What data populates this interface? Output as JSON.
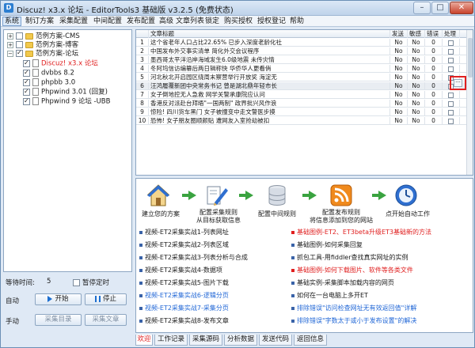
{
  "window": {
    "title": "Discuz! x3.x 论坛 - EditorTools3 基础版 v3.2.5 (免费状态)",
    "app_icon": "D",
    "min_glyph": "–",
    "max_glyph": "□",
    "close_glyph": "✕"
  },
  "menu": [
    "系统",
    "制订方案",
    "采集配置",
    "中间配置",
    "发布配置",
    "高级",
    "文章列表",
    "锁定",
    "购买授权",
    "授权登记",
    "帮助"
  ],
  "tree": [
    {
      "label": "范例方案-CMS",
      "exp": "+",
      "checked": false,
      "kind": "folder"
    },
    {
      "label": "范例方案-博客",
      "exp": "+",
      "checked": false,
      "kind": "folder"
    },
    {
      "label": "范例方案-论坛",
      "exp": "−",
      "checked": true,
      "kind": "folder"
    },
    {
      "label": "Discuz! x3.x 论坛",
      "checked": true,
      "kind": "doc",
      "red": true
    },
    {
      "label": "dvbbs 8.2",
      "checked": true,
      "kind": "doc"
    },
    {
      "label": "phpbb 3.0",
      "checked": true,
      "kind": "doc"
    },
    {
      "label": "Phpwind 3.01 (回复)",
      "checked": true,
      "kind": "doc"
    },
    {
      "label": "Phpwind 9 论坛 -UBB",
      "checked": true,
      "kind": "doc"
    }
  ],
  "controls": {
    "wait_label": "等待时间:",
    "wait_value": "5",
    "pause_label": "暂停定时",
    "auto_label": "自动",
    "start_label": "开始",
    "stop_label": "停止",
    "manual_label": "手动",
    "collect_list_label": "采集目录",
    "collect_article_label": "采集文章"
  },
  "grid": {
    "headers": [
      "",
      "文章标题",
      "发送",
      "敏感",
      "错误",
      "处理"
    ],
    "rows": [
      {
        "n": "1",
        "title": "这个省老年人口占比22.65% 已步入深度老龄化社",
        "send": "No",
        "sens": "No",
        "err": "0"
      },
      {
        "n": "2",
        "title": "中国发布外交事实清单 简化外交会议程序",
        "send": "No",
        "sens": "No",
        "err": "0"
      },
      {
        "n": "3",
        "title": "墨西哥太平洋沿岸海域发生6.0级地震 未传灾情",
        "send": "No",
        "sens": "No",
        "err": "0"
      },
      {
        "n": "4",
        "title": "冬阿坞信访编纂后两日辑称快 华侨华人更看俏",
        "send": "No",
        "sens": "No",
        "err": "0"
      },
      {
        "n": "5",
        "title": "河北秋北开启园区绕周末察营举行开放奖 海淀无",
        "send": "No",
        "sens": "No",
        "err": "0"
      },
      {
        "n": "6",
        "title": "汪鸿履覆新团中央常务书记 曾是湖北鼎年轻市长",
        "send": "No",
        "sens": "No",
        "err": "0"
      },
      {
        "n": "7",
        "title": "女子倒地控无人急救 网学关警承康院应认问",
        "send": "No",
        "sens": "No",
        "err": "0"
      },
      {
        "n": "8",
        "title": "香港反对派赴台拜晤\"一国两制\" 政界批兴风作浪",
        "send": "No",
        "sens": "No",
        "err": "0"
      },
      {
        "n": "9",
        "title": "惊险! 四川货车黑门 女子被撞变中走文警医步摸",
        "send": "No",
        "sens": "No",
        "err": "0"
      },
      {
        "n": "10",
        "title": "恐怖! 女子朋友圈顺颜贴 遭网友入室抢劫被扣",
        "send": "No",
        "sens": "No",
        "err": "0"
      }
    ]
  },
  "flow": [
    {
      "label": "建立您的方案",
      "icon": "home-icon"
    },
    {
      "label": "配置采集规则\n从目标获取信息",
      "icon": "pen-icon"
    },
    {
      "label": "配置中间规则",
      "icon": "database-icon"
    },
    {
      "label": "配置发布规则\n将信息添加到您的网站",
      "icon": "rss-icon"
    },
    {
      "label": "点开始自动工作",
      "icon": "timer-icon"
    }
  ],
  "links_left": [
    {
      "text": "视频-ET2采集实战1-列表网址",
      "style": "normal"
    },
    {
      "text": "视频-ET2采集实战2-列表区域",
      "style": "normal"
    },
    {
      "text": "视频-ET2采集实战3-列表分析与合成",
      "style": "normal"
    },
    {
      "text": "视频-ET2采集实战4-数据项",
      "style": "normal"
    },
    {
      "text": "视频-ET2采集实战5-图片下载",
      "style": "normal"
    },
    {
      "text": "视频-ET2采集实战6-逻辑分页",
      "style": "blue"
    },
    {
      "text": "视频-ET2采集实战7-采集分页",
      "style": "blue"
    },
    {
      "text": "视频-ET2采集实战8-发布文章",
      "style": "normal"
    }
  ],
  "links_right": [
    {
      "text": "基础图例-ET2、ET3beta升级ET3基础新的方法",
      "style": "red"
    },
    {
      "text": "基础图例-如何采集回复",
      "style": "normal"
    },
    {
      "text": "抓包工具-用fiddler查找真实网址的实例",
      "style": "normal"
    },
    {
      "text": "基础图例-如何下载图片、软件等各类文件",
      "style": "red"
    },
    {
      "text": "基础实例-采集脚本加载内容的网页",
      "style": "normal"
    },
    {
      "text": "如何在一台电脑上多开ET",
      "style": "normal"
    },
    {
      "text": "排除错误\"访问检查网址无有效返回值\"详解",
      "style": "blue"
    },
    {
      "text": "排除错误\"字数太于或小于发布设置\"的解决",
      "style": "blue"
    }
  ],
  "tabs": [
    "欢迎",
    "工作记录",
    "采集源码",
    "分析数据",
    "发送代码",
    "返回信息"
  ],
  "colors": {
    "accent": "#1f66d6",
    "highlight": "#e02020",
    "arrow": "#3aa340"
  }
}
